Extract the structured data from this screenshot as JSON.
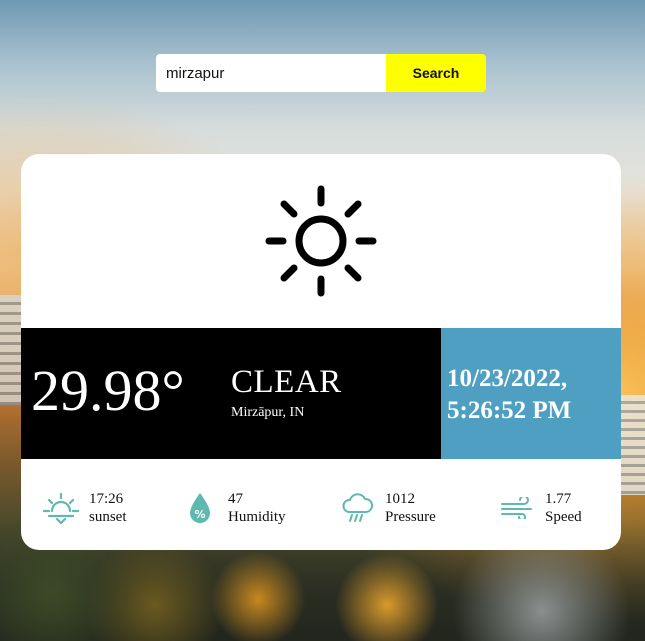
{
  "search": {
    "value": "mirzapur",
    "button_label": "Search"
  },
  "weather": {
    "icon": "sun-icon",
    "temperature": "29.98°",
    "condition": "CLEAR",
    "location": "Mirzāpur, IN"
  },
  "datetime": {
    "date": "10/23/2022,",
    "time": "5:26:52 PM"
  },
  "stats": {
    "sunset": {
      "icon": "sunset-icon",
      "value": "17:26",
      "label": "sunset"
    },
    "humidity": {
      "icon": "humidity-icon",
      "value": "47",
      "label": "Humidity"
    },
    "pressure": {
      "icon": "pressure-icon",
      "value": "1012",
      "label": "Pressure"
    },
    "speed": {
      "icon": "wind-icon",
      "value": "1.77",
      "label": "Speed"
    }
  },
  "colors": {
    "search_button": "#ffff00",
    "temp_panel": "#000000",
    "date_panel": "#4f9fc2",
    "stat_icons": "#5fb9b0"
  }
}
